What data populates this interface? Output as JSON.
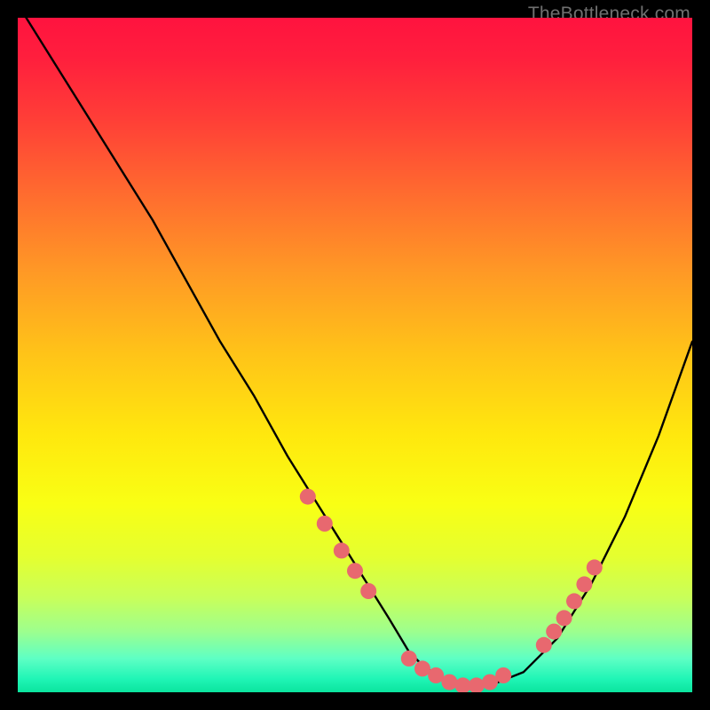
{
  "watermark": "TheBottleneck.com",
  "chart_data": {
    "type": "line",
    "title": "",
    "xlabel": "",
    "ylabel": "",
    "xlim": [
      0,
      100
    ],
    "ylim": [
      0,
      100
    ],
    "series": [
      {
        "name": "bottleneck-curve",
        "x": [
          0,
          5,
          10,
          15,
          20,
          25,
          30,
          35,
          40,
          45,
          50,
          55,
          58,
          60,
          63,
          66,
          70,
          75,
          80,
          85,
          90,
          95,
          100
        ],
        "y": [
          102,
          94,
          86,
          78,
          70,
          61,
          52,
          44,
          35,
          27,
          19,
          11,
          6,
          4,
          2,
          1,
          1,
          3,
          8,
          16,
          26,
          38,
          52
        ]
      }
    ],
    "markers": {
      "name": "highlight-dots",
      "color": "#e8686f",
      "points": [
        {
          "x": 43,
          "y": 29
        },
        {
          "x": 45.5,
          "y": 25
        },
        {
          "x": 48,
          "y": 21
        },
        {
          "x": 50,
          "y": 18
        },
        {
          "x": 52,
          "y": 15
        },
        {
          "x": 58,
          "y": 5
        },
        {
          "x": 60,
          "y": 3.5
        },
        {
          "x": 62,
          "y": 2.5
        },
        {
          "x": 64,
          "y": 1.5
        },
        {
          "x": 66,
          "y": 1
        },
        {
          "x": 68,
          "y": 1
        },
        {
          "x": 70,
          "y": 1.5
        },
        {
          "x": 72,
          "y": 2.5
        },
        {
          "x": 78,
          "y": 7
        },
        {
          "x": 79.5,
          "y": 9
        },
        {
          "x": 81,
          "y": 11
        },
        {
          "x": 82.5,
          "y": 13.5
        },
        {
          "x": 84,
          "y": 16
        },
        {
          "x": 85.5,
          "y": 18.5
        }
      ]
    }
  }
}
